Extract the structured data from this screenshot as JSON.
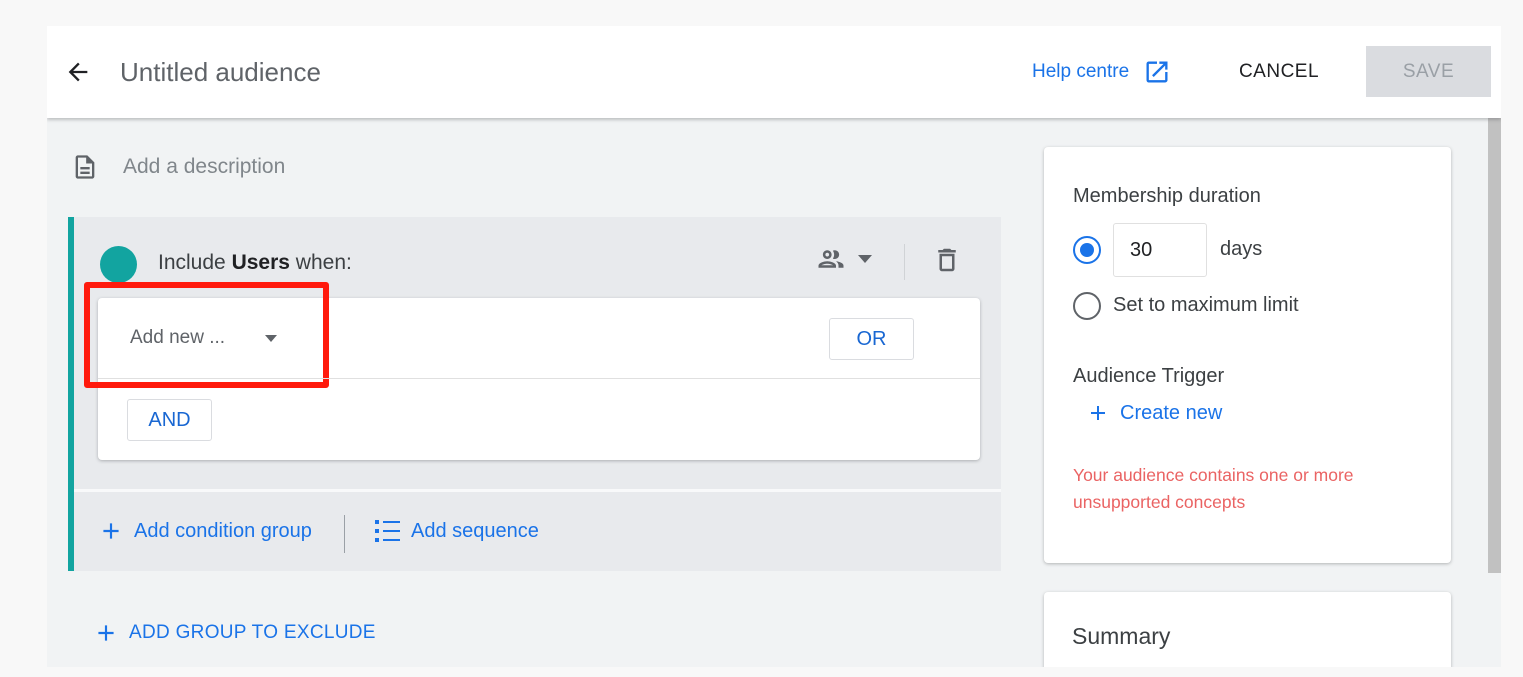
{
  "header": {
    "title": "Untitled audience",
    "help_label": "Help centre",
    "cancel_label": "CANCEL",
    "save_label": "SAVE"
  },
  "description": {
    "placeholder": "Add a description"
  },
  "include_group": {
    "prefix": "Include",
    "scope": "Users",
    "suffix": "when:",
    "dropdown_label": "Add new ...",
    "or_label": "OR",
    "and_label": "AND",
    "add_condition_group": "Add condition group",
    "add_sequence": "Add sequence"
  },
  "exclude": {
    "label": "ADD GROUP TO EXCLUDE"
  },
  "membership": {
    "title": "Membership duration",
    "days_value": "30",
    "days_unit": "days",
    "max_label": "Set to maximum limit",
    "selected": "days"
  },
  "trigger": {
    "title": "Audience Trigger",
    "create_label": "Create new"
  },
  "warning": "Your audience contains one or more unsupported concepts",
  "summary": {
    "title": "Summary"
  },
  "colors": {
    "accent": "#1a73e8",
    "group_teal": "#12a4a0",
    "highlight_red": "#ff1a0d",
    "warning_red": "#ea6363"
  }
}
